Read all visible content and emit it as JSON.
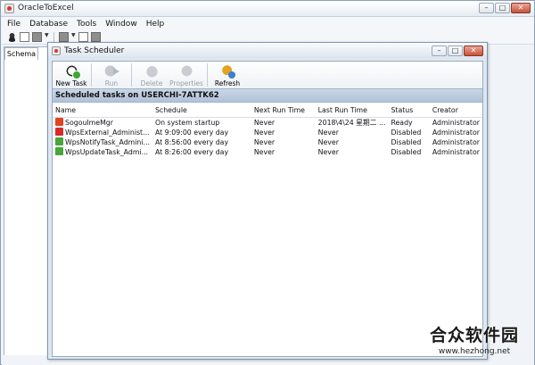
{
  "app": {
    "title": "OracleToExcel"
  },
  "menubar": {
    "items": [
      "File",
      "Database",
      "Tools",
      "Window",
      "Help"
    ]
  },
  "toolbar_icons": [
    "user-icon",
    "edit-doc-icon",
    "folder-icon",
    "dropdown-icon",
    "stop-icon",
    "dropdown-icon",
    "help-icon",
    "grid-icon"
  ],
  "left_panel": {
    "tab": "Schema"
  },
  "dialog": {
    "title": "Task Scheduler",
    "toolbar": {
      "new_task": "New Task",
      "run": "Run",
      "delete": "Delete",
      "properties": "Properties",
      "refresh": "Refresh"
    },
    "header": "Scheduled tasks on USERCHI-7ATTK62",
    "columns": [
      "Name",
      "Schedule",
      "Next Run Time",
      "Last Run Time",
      "Status",
      "Creator"
    ],
    "rows": [
      {
        "name": "SogouImeMgr",
        "schedule": "On system startup",
        "next": "Never",
        "last": "2018\\4\\24 星期二 ...",
        "status": "Ready",
        "creator": "Administrator",
        "icon": "sogou-icon"
      },
      {
        "name": "WpsExternal_Administ...",
        "schedule": "At 9:09:00 every day",
        "next": "Never",
        "last": "Never",
        "status": "Disabled",
        "creator": "Administrator",
        "icon": "wps-icon"
      },
      {
        "name": "WpsNotifyTask_Admini...",
        "schedule": "At 8:56:00 every day",
        "next": "Never",
        "last": "Never",
        "status": "Disabled",
        "creator": "Administrator",
        "icon": "wps-green-icon"
      },
      {
        "name": "WpsUpdateTask_Admi...",
        "schedule": "At 8:26:00 every day",
        "next": "Never",
        "last": "Never",
        "status": "Disabled",
        "creator": "Administrator",
        "icon": "wps-green-icon"
      }
    ]
  },
  "watermark": {
    "line1": "合众软件园",
    "line2": "www.hezhong.net"
  }
}
